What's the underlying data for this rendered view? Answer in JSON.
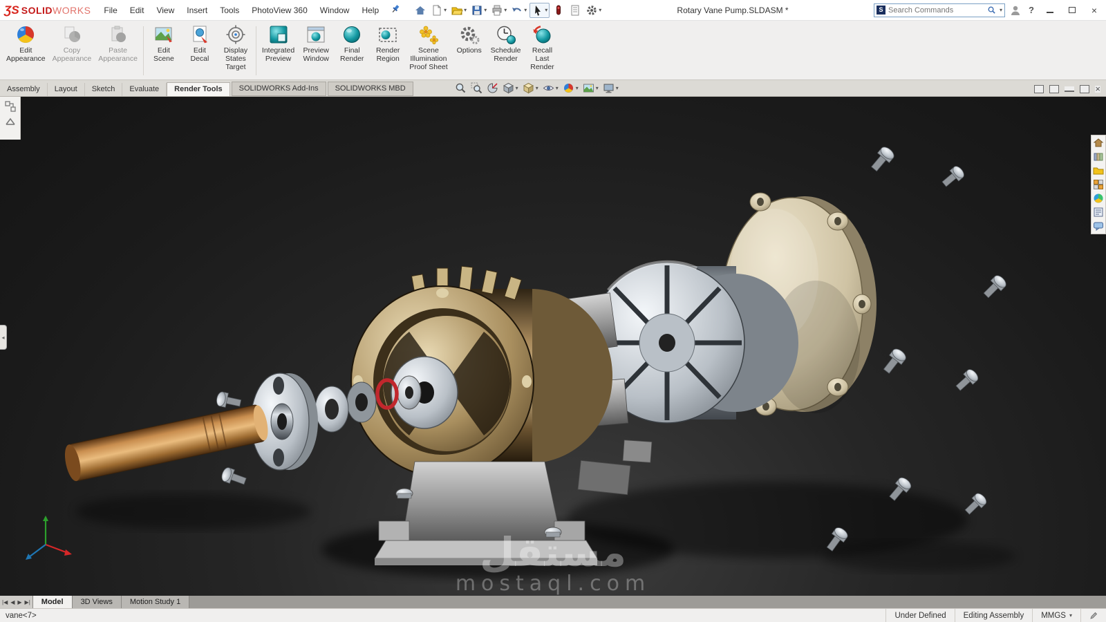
{
  "window": {
    "logo_swirl": "ƷS",
    "logo_prefix": "SOLID",
    "logo_suffix": "WORKS",
    "title": "Rotary Vane Pump.SLDASM *",
    "search_placeholder": "Search Commands",
    "help_label": "?"
  },
  "menubar": {
    "items": [
      "File",
      "Edit",
      "View",
      "Insert",
      "Tools",
      "PhotoView 360",
      "Window",
      "Help"
    ]
  },
  "ribbon": {
    "buttons": [
      {
        "label": "Edit\nAppearance"
      },
      {
        "label": "Copy\nAppearance"
      },
      {
        "label": "Paste\nAppearance"
      },
      {
        "label": "Edit\nScene"
      },
      {
        "label": "Edit\nDecal"
      },
      {
        "label": "Display\nStates\nTarget"
      },
      {
        "label": "Integrated\nPreview"
      },
      {
        "label": "Preview\nWindow"
      },
      {
        "label": "Final\nRender"
      },
      {
        "label": "Render\nRegion"
      },
      {
        "label": "Scene\nIllumination\nProof Sheet"
      },
      {
        "label": "Options"
      },
      {
        "label": "Schedule\nRender"
      },
      {
        "label": "Recall\nLast\nRender"
      }
    ]
  },
  "tabs": {
    "items": [
      "Assembly",
      "Layout",
      "Sketch",
      "Evaluate",
      "Render Tools",
      "SOLIDWORKS Add-Ins",
      "SOLIDWORKS MBD"
    ],
    "active": "Render Tools"
  },
  "doc_tabs": {
    "items": [
      "Model",
      "3D Views",
      "Motion Study 1"
    ],
    "active": "Model"
  },
  "statusbar": {
    "left": "vane<7>",
    "state": "Under Defined",
    "mode": "Editing Assembly",
    "units": "MMGS"
  },
  "watermark": {
    "line1": "مستقل",
    "line2": "mostaql.com"
  },
  "colors": {
    "brand_red": "#c41818",
    "teal": "#1499a2",
    "viewport_bg": "#1b1b1b"
  }
}
